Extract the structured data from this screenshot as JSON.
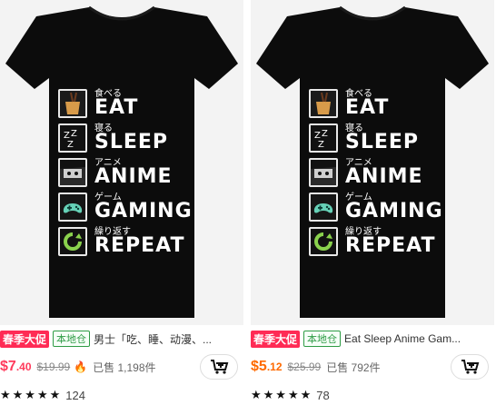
{
  "cards": [
    {
      "design_rows": [
        {
          "jp": "食べる",
          "word": "EAT",
          "icon": "noodle-box-icon"
        },
        {
          "jp": "寝る",
          "word": "SLEEP",
          "icon": "zzz-icon"
        },
        {
          "jp": "アニメ",
          "word": "ANIME",
          "icon": "anime-face-icon"
        },
        {
          "jp": "ゲーム",
          "word": "GAMING",
          "icon": "gamepad-icon"
        },
        {
          "jp": "繰り返す",
          "word": "REPEAT",
          "icon": "repeat-icon"
        }
      ],
      "promo_badge": "春季大促",
      "local_badge": "本地仓",
      "title": "男士「吃、睡、动漫、...",
      "price_currency": "$",
      "price_main": "7",
      "price_cents": ".40",
      "original_price": "$19.99",
      "sold_text": "已售 1,198件",
      "rating_count": "124"
    },
    {
      "design_rows": [
        {
          "jp": "食べる",
          "word": "EAT",
          "icon": "noodle-box-icon"
        },
        {
          "jp": "寝る",
          "word": "SLEEP",
          "icon": "zzz-icon"
        },
        {
          "jp": "アニメ",
          "word": "ANIME",
          "icon": "anime-face-icon"
        },
        {
          "jp": "ゲーム",
          "word": "GAMING",
          "icon": "gamepad-icon"
        },
        {
          "jp": "繰り返す",
          "word": "REPEAT",
          "icon": "repeat-icon"
        }
      ],
      "promo_badge": "春季大促",
      "local_badge": "本地仓",
      "title": "Eat Sleep Anime Gam...",
      "price_currency": "$",
      "price_main": "5",
      "price_cents": ".12",
      "original_price": "$25.99",
      "sold_text": "已售 792件",
      "rating_count": "78"
    }
  ],
  "colors": {
    "promo": "#ff2b55",
    "local": "#2e9b45",
    "price": "#ff3b5c"
  }
}
